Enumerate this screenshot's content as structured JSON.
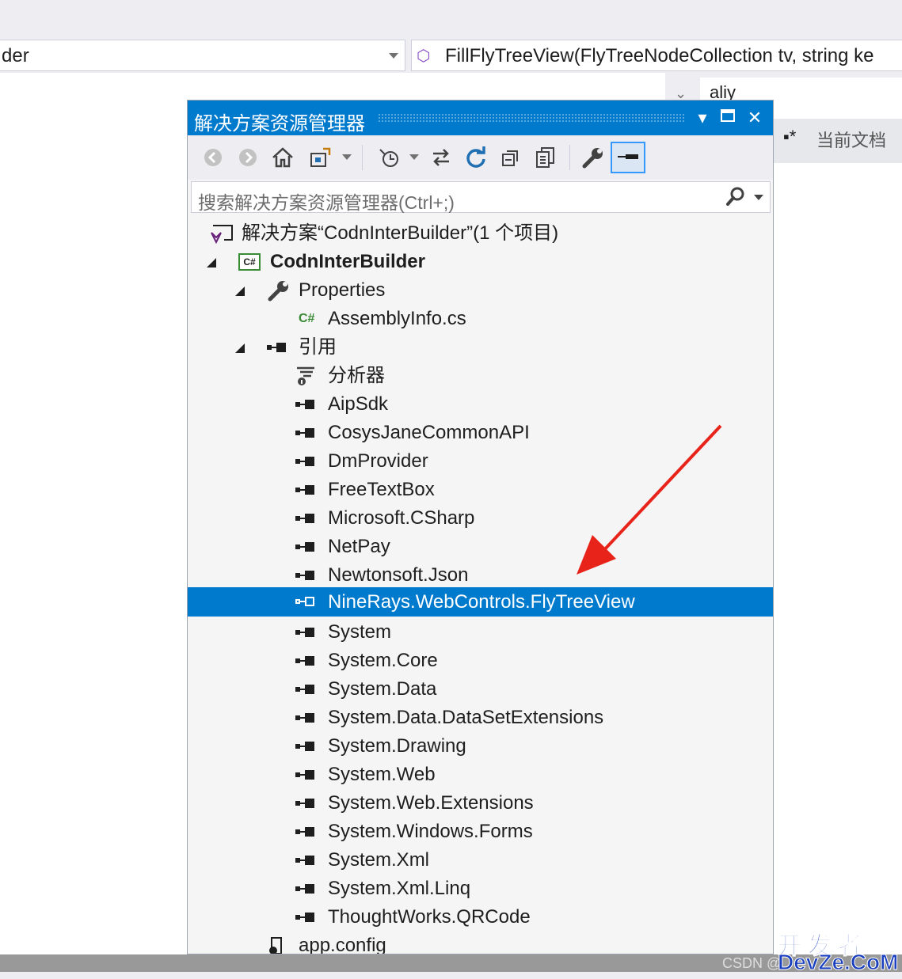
{
  "editor": {
    "class_combo": "der",
    "member_combo": "FillFlyTreeView(FlyTreeNodeCollection tv, string ke",
    "search_partial": "aliy",
    "current_doc_label": "当前文档"
  },
  "panel": {
    "title": "解决方案资源管理器",
    "search_placeholder": "搜索解决方案资源管理器(Ctrl+;)"
  },
  "tree": {
    "solution": "解决方案“CodnInterBuilder”(1 个项目)",
    "project": "CodnInterBuilder",
    "properties": "Properties",
    "assemblyinfo": "AssemblyInfo.cs",
    "references": "引用",
    "analyzers": "分析器",
    "refs": [
      "AipSdk",
      "CosysJaneCommonAPI",
      "DmProvider",
      "FreeTextBox",
      "Microsoft.CSharp",
      "NetPay",
      "Newtonsoft.Json",
      "NineRays.WebControls.FlyTreeView",
      "System",
      "System.Core",
      "System.Data",
      "System.Data.DataSetExtensions",
      "System.Drawing",
      "System.Web",
      "System.Web.Extensions",
      "System.Windows.Forms",
      "System.Xml",
      "System.Xml.Linq",
      "ThoughtWorks.QRCode"
    ],
    "app_config": "app.config"
  },
  "watermark": {
    "csdn": "CSDN @",
    "site_cn": "开发者",
    "site_en": "DevZe.CoM"
  },
  "colors": {
    "accent": "#007acc",
    "arrow": "#e8231a"
  },
  "icons": {
    "toolbar": [
      "back-icon",
      "forward-icon",
      "home-icon",
      "switch-views-icon",
      "pending-changes-icon",
      "sync-icon",
      "refresh-icon",
      "collapse-all-icon",
      "copy-icon",
      "properties-wrench-icon",
      "preview-icon"
    ]
  }
}
